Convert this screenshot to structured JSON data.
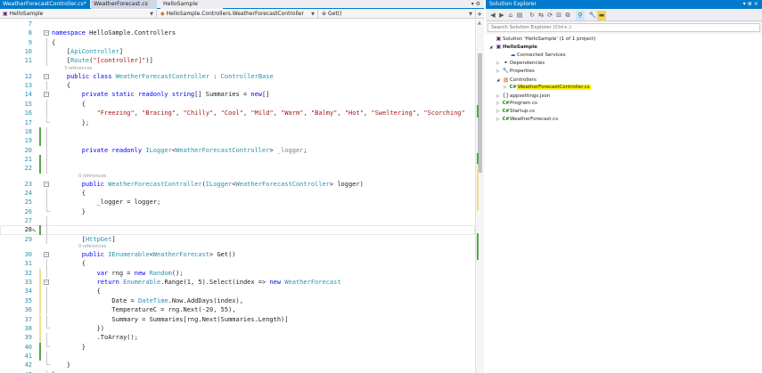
{
  "editor": {
    "tabs": [
      {
        "label": "WeatherForecastController.cs*",
        "close": "⊕ ×",
        "state": "active"
      },
      {
        "label": "WeatherForecast.cs",
        "close": "",
        "state": "inactive"
      },
      {
        "label": "HelloSample",
        "close": "",
        "state": "preview"
      }
    ],
    "tab_overflow": "▾ ⚙",
    "nav": {
      "project": "HelloSample",
      "class": "HelloSample.Controllers.WeatherForecastController",
      "member": "Get()",
      "split": "+"
    }
  },
  "code_lines": [
    {
      "n": "7",
      "parts": []
    },
    {
      "n": "8",
      "parts": [
        {
          "c": "k",
          "t": "namespace"
        },
        {
          "c": "p",
          "t": " HelloSample.Controllers"
        }
      ]
    },
    {
      "n": "9",
      "parts": [
        {
          "c": "p",
          "t": "{"
        }
      ]
    },
    {
      "n": "10",
      "parts": [
        {
          "c": "p",
          "t": "    ["
        },
        {
          "c": "t",
          "t": "ApiController"
        },
        {
          "c": "p",
          "t": "]"
        }
      ]
    },
    {
      "n": "11",
      "parts": [
        {
          "c": "p",
          "t": "    ["
        },
        {
          "c": "t",
          "t": "Route"
        },
        {
          "c": "p",
          "t": "("
        },
        {
          "c": "s",
          "t": "\"[controller]\""
        },
        {
          "c": "p",
          "t": ")]"
        }
      ]
    },
    {
      "n": "12",
      "parts": [
        {
          "c": "k",
          "t": "    public class "
        },
        {
          "c": "t",
          "t": "WeatherForecastController"
        },
        {
          "c": "p",
          "t": " : "
        },
        {
          "c": "t",
          "t": "ControllerBase"
        }
      ]
    },
    {
      "n": "13",
      "parts": [
        {
          "c": "p",
          "t": "    {"
        }
      ]
    },
    {
      "n": "14",
      "parts": [
        {
          "c": "k",
          "t": "        private static readonly string"
        },
        {
          "c": "p",
          "t": "[] Summaries = "
        },
        {
          "c": "k",
          "t": "new"
        },
        {
          "c": "p",
          "t": "[]"
        }
      ]
    },
    {
      "n": "15",
      "parts": [
        {
          "c": "p",
          "t": "        {"
        }
      ]
    },
    {
      "n": "16",
      "parts": [
        {
          "c": "s",
          "t": "            \"Freezing\""
        },
        {
          "c": "p",
          "t": ", "
        },
        {
          "c": "s",
          "t": "\"Bracing\""
        },
        {
          "c": "p",
          "t": ", "
        },
        {
          "c": "s",
          "t": "\"Chilly\""
        },
        {
          "c": "p",
          "t": ", "
        },
        {
          "c": "s",
          "t": "\"Cool\""
        },
        {
          "c": "p",
          "t": ", "
        },
        {
          "c": "s",
          "t": "\"Mild\""
        },
        {
          "c": "p",
          "t": ", "
        },
        {
          "c": "s",
          "t": "\"Warm\""
        },
        {
          "c": "p",
          "t": ", "
        },
        {
          "c": "s",
          "t": "\"Balmy\""
        },
        {
          "c": "p",
          "t": ", "
        },
        {
          "c": "s",
          "t": "\"Hot\""
        },
        {
          "c": "p",
          "t": ", "
        },
        {
          "c": "s",
          "t": "\"Sweltering\""
        },
        {
          "c": "p",
          "t": ", "
        },
        {
          "c": "s",
          "t": "\"Scorching\""
        }
      ]
    },
    {
      "n": "17",
      "parts": [
        {
          "c": "p",
          "t": "        };"
        }
      ]
    },
    {
      "n": "18",
      "parts": []
    },
    {
      "n": "19",
      "parts": []
    },
    {
      "n": "20",
      "parts": [
        {
          "c": "k",
          "t": "        private readonly "
        },
        {
          "c": "t",
          "t": "ILogger"
        },
        {
          "c": "p",
          "t": "<"
        },
        {
          "c": "t",
          "t": "WeatherForecastController"
        },
        {
          "c": "p",
          "t": "> "
        },
        {
          "c": "u",
          "t": "_logger"
        },
        {
          "c": "p",
          "t": ";"
        }
      ]
    },
    {
      "n": "21",
      "parts": []
    },
    {
      "n": "22",
      "parts": []
    },
    {
      "n": "23",
      "parts": [
        {
          "c": "k",
          "t": "        public "
        },
        {
          "c": "t",
          "t": "WeatherForecastController"
        },
        {
          "c": "p",
          "t": "("
        },
        {
          "c": "t",
          "t": "ILogger"
        },
        {
          "c": "p",
          "t": "<"
        },
        {
          "c": "t",
          "t": "WeatherForecastController"
        },
        {
          "c": "p",
          "t": "> logger)"
        }
      ]
    },
    {
      "n": "24",
      "parts": [
        {
          "c": "p",
          "t": "        {"
        }
      ]
    },
    {
      "n": "25",
      "parts": [
        {
          "c": "p",
          "t": "            _logger = logger;"
        }
      ]
    },
    {
      "n": "26",
      "parts": [
        {
          "c": "p",
          "t": "        }"
        }
      ]
    },
    {
      "n": "27",
      "parts": []
    },
    {
      "n": "28",
      "parts": [
        {
          "c": "p",
          "t": "        "
        }
      ]
    },
    {
      "n": "29",
      "parts": [
        {
          "c": "p",
          "t": "        ["
        },
        {
          "c": "t",
          "t": "HttpGet"
        },
        {
          "c": "p",
          "t": "]"
        }
      ]
    },
    {
      "n": "30",
      "parts": [
        {
          "c": "k",
          "t": "        public "
        },
        {
          "c": "t",
          "t": "IEnumerable"
        },
        {
          "c": "p",
          "t": "<"
        },
        {
          "c": "t",
          "t": "WeatherForecast"
        },
        {
          "c": "p",
          "t": "> Get()"
        }
      ]
    },
    {
      "n": "31",
      "parts": [
        {
          "c": "p",
          "t": "        {"
        }
      ]
    },
    {
      "n": "32",
      "parts": [
        {
          "c": "k",
          "t": "            var"
        },
        {
          "c": "p",
          "t": " rng = "
        },
        {
          "c": "k",
          "t": "new "
        },
        {
          "c": "t",
          "t": "Random"
        },
        {
          "c": "p",
          "t": "();"
        }
      ]
    },
    {
      "n": "33",
      "parts": [
        {
          "c": "k",
          "t": "            return "
        },
        {
          "c": "t",
          "t": "Enumerable"
        },
        {
          "c": "p",
          "t": ".Range(1, 5).Select(index => "
        },
        {
          "c": "k",
          "t": "new "
        },
        {
          "c": "t",
          "t": "WeatherForecast"
        }
      ]
    },
    {
      "n": "34",
      "parts": [
        {
          "c": "p",
          "t": "            {"
        }
      ]
    },
    {
      "n": "35",
      "parts": [
        {
          "c": "p",
          "t": "                Date = "
        },
        {
          "c": "t",
          "t": "DateTime"
        },
        {
          "c": "p",
          "t": ".Now.AddDays(index),"
        }
      ]
    },
    {
      "n": "36",
      "parts": [
        {
          "c": "p",
          "t": "                TemperatureC = rng.Next(-20, 55),"
        }
      ]
    },
    {
      "n": "37",
      "parts": [
        {
          "c": "p",
          "t": "                Summary = Summaries[rng.Next(Summaries.Length)]"
        }
      ]
    },
    {
      "n": "38",
      "parts": [
        {
          "c": "p",
          "t": "            })"
        }
      ]
    },
    {
      "n": "39",
      "parts": [
        {
          "c": "p",
          "t": "            .ToArray();"
        }
      ]
    },
    {
      "n": "40",
      "parts": [
        {
          "c": "p",
          "t": "        }"
        }
      ]
    },
    {
      "n": "41",
      "parts": []
    },
    {
      "n": "42",
      "parts": [
        {
          "c": "p",
          "t": "    }"
        }
      ]
    },
    {
      "n": "43",
      "parts": [
        {
          "c": "p",
          "t": "}"
        }
      ]
    }
  ],
  "code_lens": {
    "class_refs": "3 references",
    "ctor_refs": "0 references",
    "get_refs": "0 references"
  },
  "solution_explorer": {
    "title": "Solution Explorer",
    "title_controls": "▾ ⊕ ×",
    "search_placeholder": "Search Solution Explorer (Ctrl+;)",
    "tree": [
      {
        "label": "Solution 'HelloSample' (1 of 1 project)",
        "icon": "sol",
        "glyph": "▣",
        "exp": "",
        "depth": 0
      },
      {
        "label": "HelloSample",
        "icon": "proj",
        "glyph": "▣",
        "exp": "◢",
        "depth": 0,
        "bold": true
      },
      {
        "label": "Connected Services",
        "icon": "svc",
        "glyph": "☁",
        "exp": "",
        "depth": 2
      },
      {
        "label": "Dependencies",
        "icon": "dep",
        "glyph": "⚭",
        "exp": "▷",
        "depth": 1
      },
      {
        "label": "Properties",
        "icon": "prop",
        "glyph": "🔧",
        "exp": "▷",
        "depth": 1
      },
      {
        "label": "Controllers",
        "icon": "folder",
        "glyph": "▆",
        "exp": "◢",
        "depth": 1
      },
      {
        "label": "WeatherForecastController.cs",
        "icon": "cs",
        "glyph": "C#",
        "exp": "▷",
        "depth": 2,
        "selected": true
      },
      {
        "label": "appsettings.json",
        "icon": "json",
        "glyph": "{}",
        "exp": "▷",
        "depth": 1
      },
      {
        "label": "Program.cs",
        "icon": "cs",
        "glyph": "C#",
        "exp": "▷",
        "depth": 1
      },
      {
        "label": "Startup.cs",
        "icon": "cs",
        "glyph": "C#",
        "exp": "▷",
        "depth": 1
      },
      {
        "label": "WeatherForecast.cs",
        "icon": "cs",
        "glyph": "C#",
        "exp": "▷",
        "depth": 1
      }
    ]
  },
  "colors": {
    "accent": "#007acc",
    "keyword": "#0000ff",
    "type": "#2b91af",
    "string": "#a31515",
    "saved_change": "#57a64a",
    "unsaved_change": "#efe08f",
    "highlight": "#fff200"
  }
}
